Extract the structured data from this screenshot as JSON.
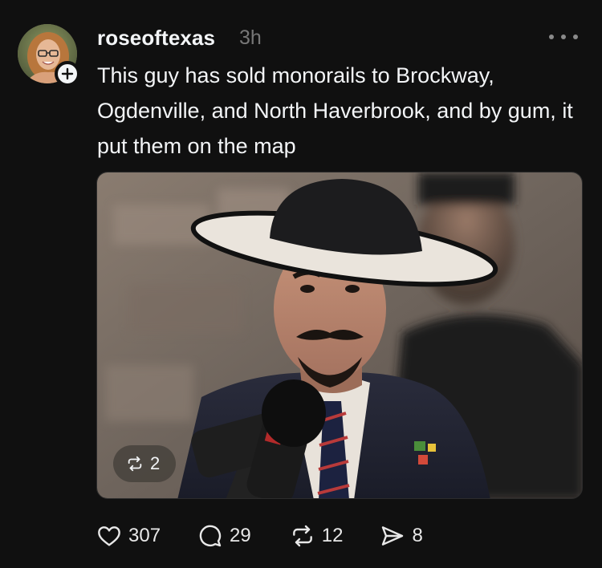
{
  "post": {
    "username": "roseoftexas",
    "timestamp": "3h",
    "text": "This guy has sold monorails to Brockway, Ogdenville, and North Haverbrook, and by gum, it put them on the map",
    "media": {
      "repost_badge_count": "2",
      "repost_badge_icon": "repost-icon"
    },
    "actions": {
      "likes": "307",
      "replies": "29",
      "reposts": "12",
      "shares": "8"
    },
    "icons": {
      "like": "heart-icon",
      "reply": "speech-bubble-icon",
      "repost": "repost-icon",
      "share": "send-icon",
      "more": "more-icon",
      "follow": "plus-icon"
    }
  },
  "colors": {
    "background": "#101010",
    "text_primary": "#f3f5f7",
    "text_secondary": "#777777"
  }
}
